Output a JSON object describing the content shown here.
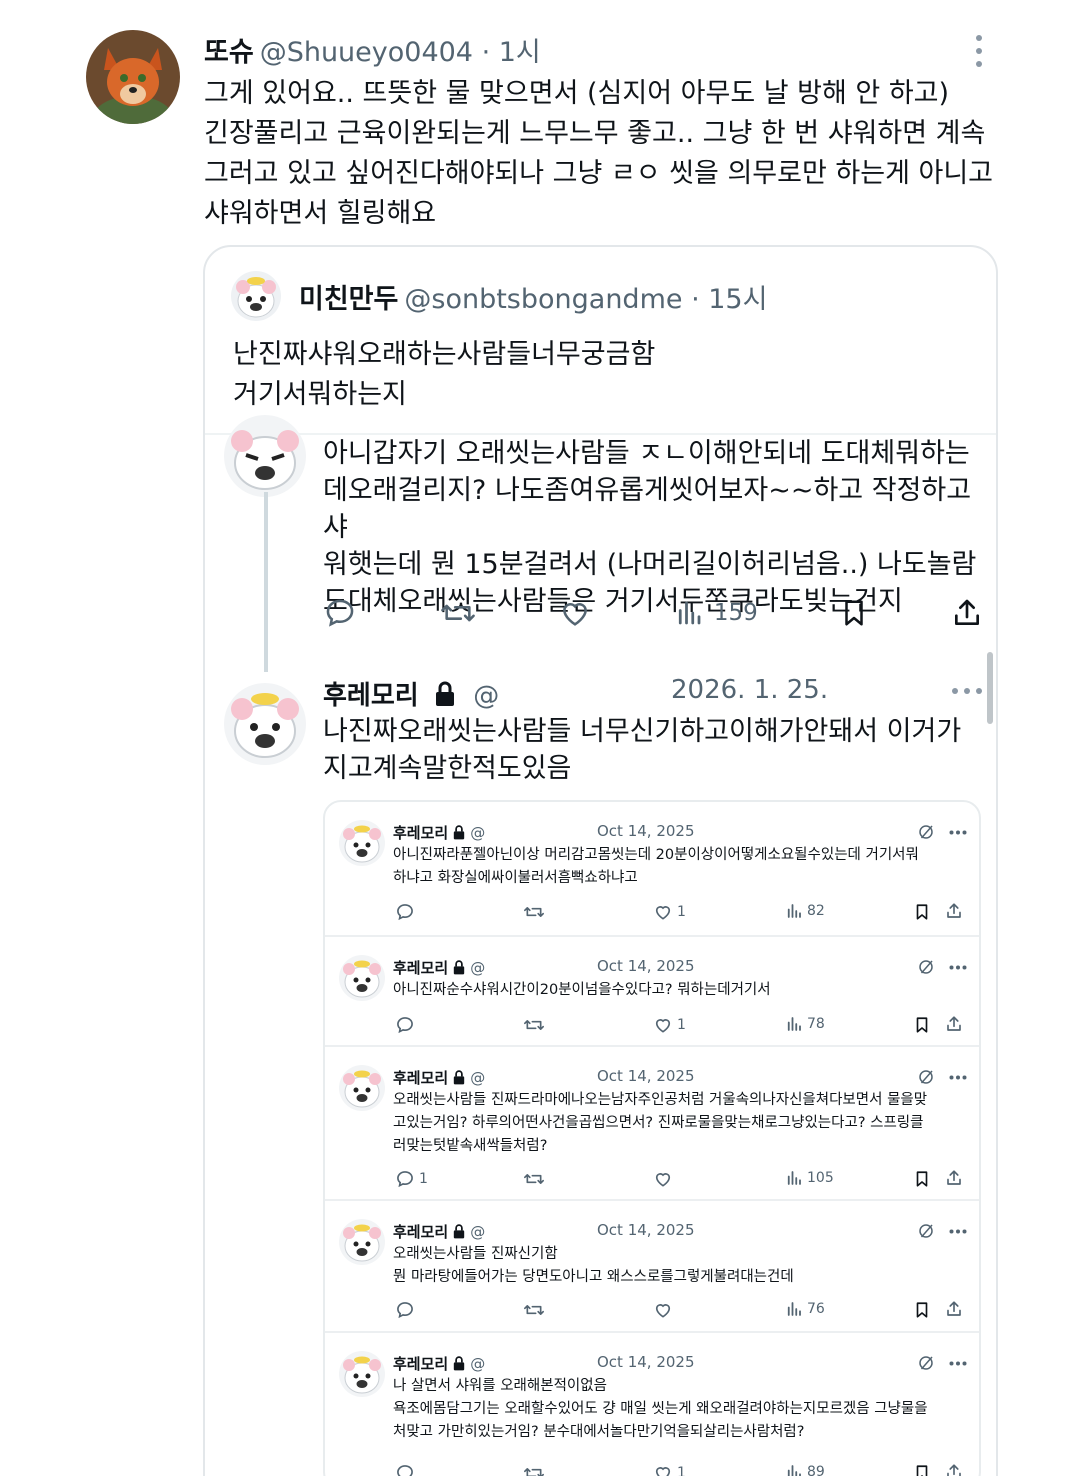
{
  "tweet": {
    "author_name": "또슈",
    "meta": "@Shuueyo0404 · 1시",
    "text": "그게 있어요.. 뜨뜻한 물 맞으면서 (심지어 아무도 날 방해 안 하고)\n긴장풀리고 근육이완되는게 느무느무 좋고.. 그냥 한 번 샤워하면 계속\n그러고 있고 싶어진다해야되나 그냥 ㄹㅇ 씻을 의무로만 하는게 아니고\n샤워하면서 힐링해요"
  },
  "quote": {
    "author_name": "미친만두",
    "meta": "@sonbtsbongandme · 15시",
    "text": "난진짜샤워오래하는사람들너무궁금함\n거기서뭐하는지",
    "reply1": {
      "text": "아니갑자기 오래씻는사람들 ㅈㄴ이해안되네 도대체뭐하는\n데오래걸리지? 나도좀여유롭게씻어보자~~하고 작정하고샤\n워햇는데 뭔 15분걸려서 (나머리길이허리넘음..) 나도놀람\n도대체오래씻는사람들은 거기서두쫀쿠라도빚는건지",
      "views": "159"
    },
    "reply2": {
      "author_name": "후레모리",
      "handle": "@",
      "date": "2026. 1. 25.",
      "text": "나진짜오래씻는사람들 너무신기하고이해가안돼서 이거가\n지고계속말한적도있음"
    }
  },
  "embedded_tweets": [
    {
      "name": "후레모리",
      "handle": "@",
      "date": "Oct 14, 2025",
      "text": "아니진짜라푼젤아닌이상 머리감고몸씻는데 20분이상이어떻게소요될수있는데 거기서뭐\n하냐고 화장실에싸이불러서흠뻑쇼하냐고",
      "replies": "",
      "likes": "1",
      "views": "82"
    },
    {
      "name": "후레모리",
      "handle": "@",
      "date": "Oct 14, 2025",
      "text": "아니진짜순수샤워시간이20분이넘을수있다고? 뭐하는데거기서",
      "replies": "",
      "likes": "1",
      "views": "78"
    },
    {
      "name": "후레모리",
      "handle": "@",
      "date": "Oct 14, 2025",
      "text": "오래씻는사람들 진짜드라마에나오는남자주인공처럼 거울속의나자신을쳐다보면서 물을맞\n고있는거임? 하루의어떤사건을곱씹으면서? 진짜로물을맞는채로그냥있는다고? 스프링클\n러맞는텃밭속새싹들처럼?",
      "replies": "1",
      "likes": "",
      "views": "105"
    },
    {
      "name": "후레모리",
      "handle": "@",
      "date": "Oct 14, 2025",
      "text": "오래씻는사람들 진짜신기함\n뭔 마라탕에들어가는 당면도아니고 왜스스로를그렇게불려대는건데",
      "replies": "",
      "likes": "",
      "views": "76"
    },
    {
      "name": "후레모리",
      "handle": "@",
      "date": "Oct 14, 2025",
      "text": "나 살면서 샤워를 오래해본적이없음\n욕조에몸담그기는 오래할수있어도 걍 매일 씻는게 왜오래걸려야하는지모르겠음 그냥물을\n처맞고 가만히있는거임? 분수대에서놀다만기억을되살리는사람처럼?",
      "replies": "",
      "likes": "1",
      "views": "89"
    }
  ]
}
